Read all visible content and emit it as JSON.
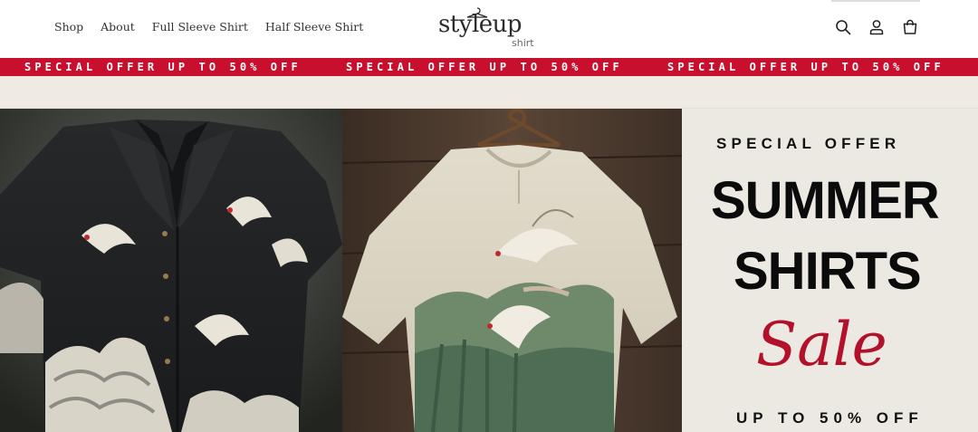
{
  "header": {
    "nav": [
      "Shop",
      "About",
      "Full Sleeve Shirt",
      "Half Sleeve Shirt"
    ],
    "logo": {
      "main": "styleup",
      "sub": "shirt"
    },
    "icons": [
      "search-icon",
      "account-icon",
      "cart-icon"
    ]
  },
  "banner": {
    "text": "SPECIAL OFFER UP TO 50% OFF",
    "background": "#c8102e",
    "text_color": "#ffffff"
  },
  "hero": {
    "left_image": "black-crane-embroidered-shirt",
    "middle_image": "cream-crane-embroidered-shirt",
    "kicker": "SPECIAL OFFER",
    "title_line1": "SUMMER",
    "title_line2": "SHIRTS",
    "script": "Sale",
    "tagline": "UP TO 50% OFF",
    "accent": "#b3102a"
  }
}
